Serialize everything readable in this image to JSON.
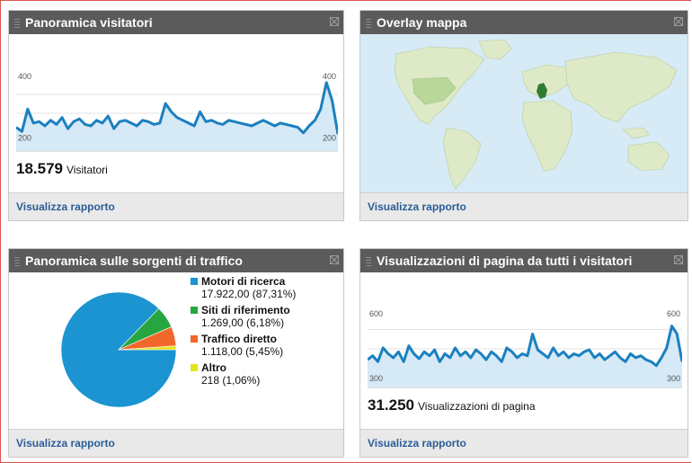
{
  "widgets": {
    "visitors": {
      "title": "Panoramica visitatori",
      "total": "18.579",
      "unit": "Visitatori",
      "y_max_label": "400",
      "y_min_label": "200",
      "link": "Visualizza rapporto"
    },
    "map": {
      "title": "Overlay mappa",
      "link": "Visualizza rapporto",
      "highlight_colors": {
        "land": "#dde9c7",
        "light": "#b9d79a",
        "dark": "#2f7d32",
        "water": "#d7ebf6"
      }
    },
    "traffic": {
      "title": "Panoramica sulle sorgenti di traffico",
      "link": "Visualizza rapporto"
    },
    "pageviews": {
      "title": "Visualizzazioni di pagina da tutti i visitatori",
      "total": "31.250",
      "unit": "Visualizzazioni di pagina",
      "y_max_label": "600",
      "y_min_label": "300",
      "link": "Visualizza rapporto"
    }
  },
  "chart_data": [
    {
      "type": "line",
      "series": [
        {
          "values": [
            235,
            220,
            300,
            250,
            255,
            240,
            260,
            245,
            270,
            230,
            255,
            265,
            245,
            240,
            260,
            250,
            275,
            230,
            255,
            260,
            250,
            240,
            260,
            255,
            245,
            250,
            320,
            290,
            270,
            260,
            250,
            240,
            290,
            255,
            260,
            250,
            245,
            260,
            255,
            250,
            245,
            240,
            250,
            260,
            250,
            240,
            250,
            245,
            240,
            235,
            215,
            240,
            260,
            300,
            395,
            330,
            210
          ]
        }
      ],
      "ylim": [
        150,
        420
      ],
      "yticks": [
        "400",
        "200"
      ],
      "color": "#1b80c0"
    },
    {
      "type": "pie",
      "labels": [
        "Motori di ricerca",
        "Siti di riferimento",
        "Traffico diretto",
        "Altro"
      ],
      "values": [
        17922,
        1269,
        1118,
        218
      ],
      "percent": [
        87.31,
        6.18,
        5.45,
        1.06
      ],
      "value_labels": [
        "17.922,00 (87,31%)",
        "1.269,00 (6,18%)",
        "1.118,00 (5,45%)",
        "218 (1,06%)"
      ],
      "colors": [
        "#1b94d1",
        "#27a640",
        "#f2672c",
        "#e7e31c"
      ]
    },
    {
      "type": "line",
      "series": [
        {
          "values": [
            390,
            410,
            380,
            450,
            420,
            400,
            430,
            380,
            460,
            420,
            395,
            430,
            410,
            440,
            380,
            420,
            400,
            450,
            410,
            430,
            400,
            440,
            420,
            390,
            430,
            410,
            380,
            450,
            430,
            400,
            420,
            410,
            520,
            440,
            420,
            400,
            450,
            410,
            430,
            400,
            420,
            410,
            430,
            440,
            400,
            420,
            390,
            410,
            430,
            400,
            380,
            420,
            400,
            410,
            390,
            380,
            360,
            400,
            450,
            560,
            520,
            380
          ]
        }
      ],
      "ylim": [
        250,
        640
      ],
      "yticks": [
        "600",
        "300"
      ],
      "color": "#1b80c0"
    }
  ]
}
